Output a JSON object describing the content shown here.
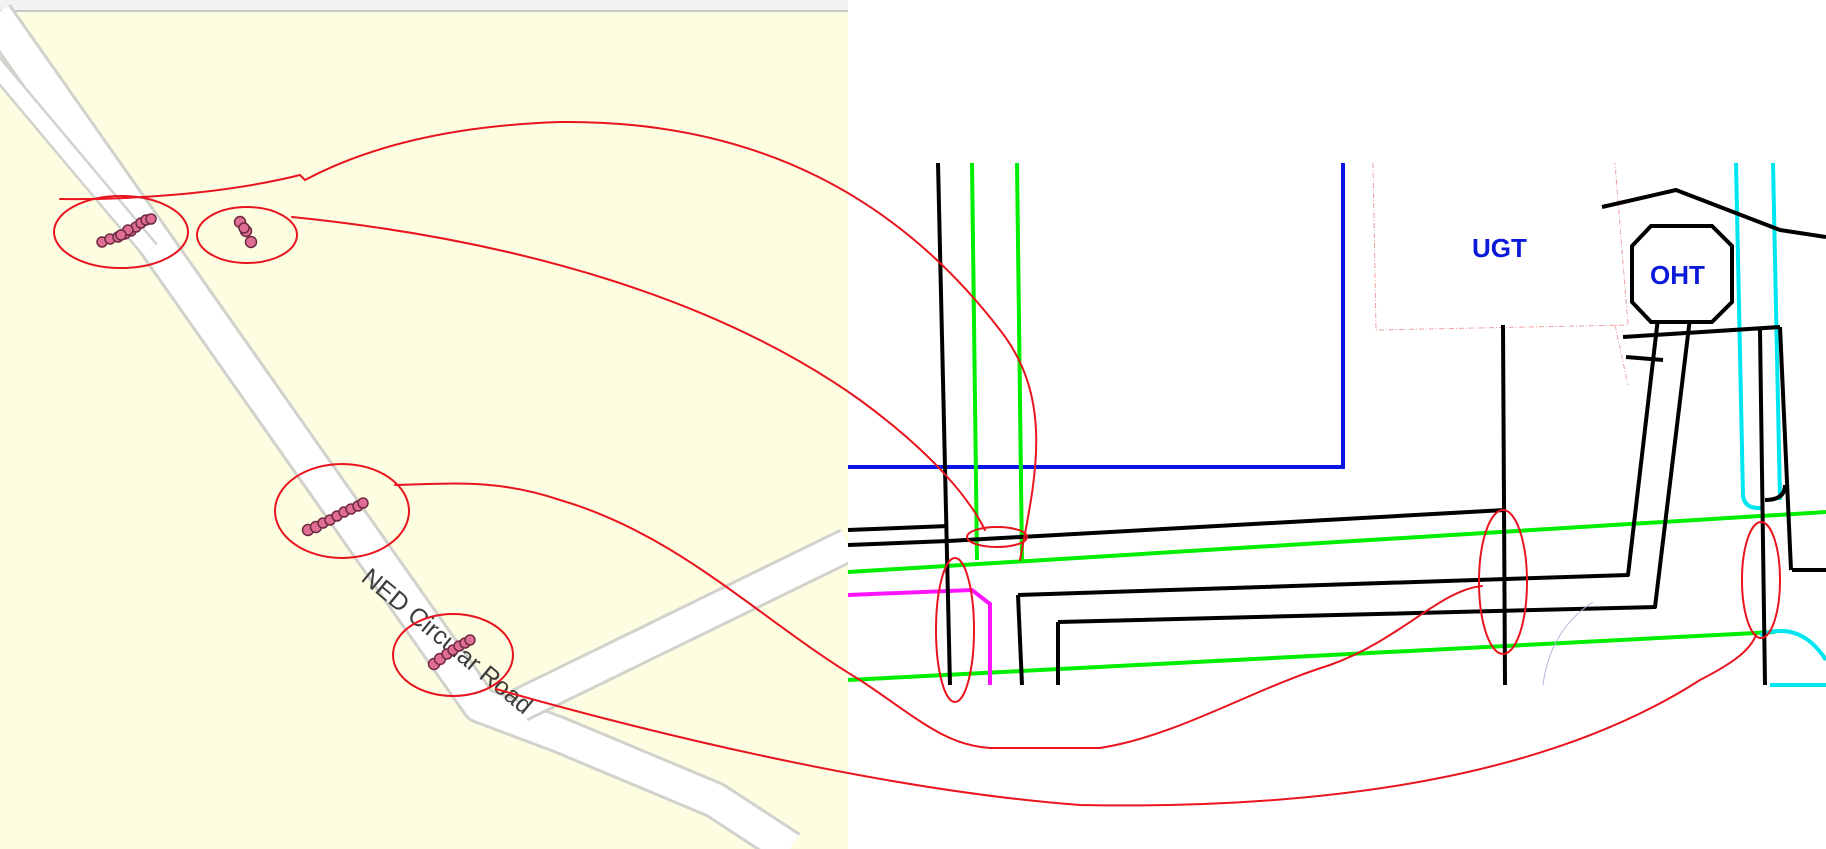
{
  "left_map": {
    "road_label": "NED Circular Road",
    "colors": {
      "background": "#fdfde1",
      "road_fill": "#ffffff",
      "road_edge": "#d2d2cd",
      "marker_fill": "#e06d93",
      "marker_stroke": "#6e2a40",
      "annotation": "#e8141e"
    }
  },
  "right_drawing": {
    "labels": {
      "ugt": "UGT",
      "oht": "OHT"
    },
    "colors": {
      "black_line": "#000000",
      "green_line": "#00ee00",
      "blue_line": "#0a14e6",
      "magenta_line": "#ff14ff",
      "cyan_line": "#00e6f0",
      "label_text": "#0a1ad8",
      "boundary": "#f0a0a0"
    }
  },
  "annotations": {
    "color": "#e8141e",
    "circled_groups": 4,
    "connector_count": 4
  }
}
